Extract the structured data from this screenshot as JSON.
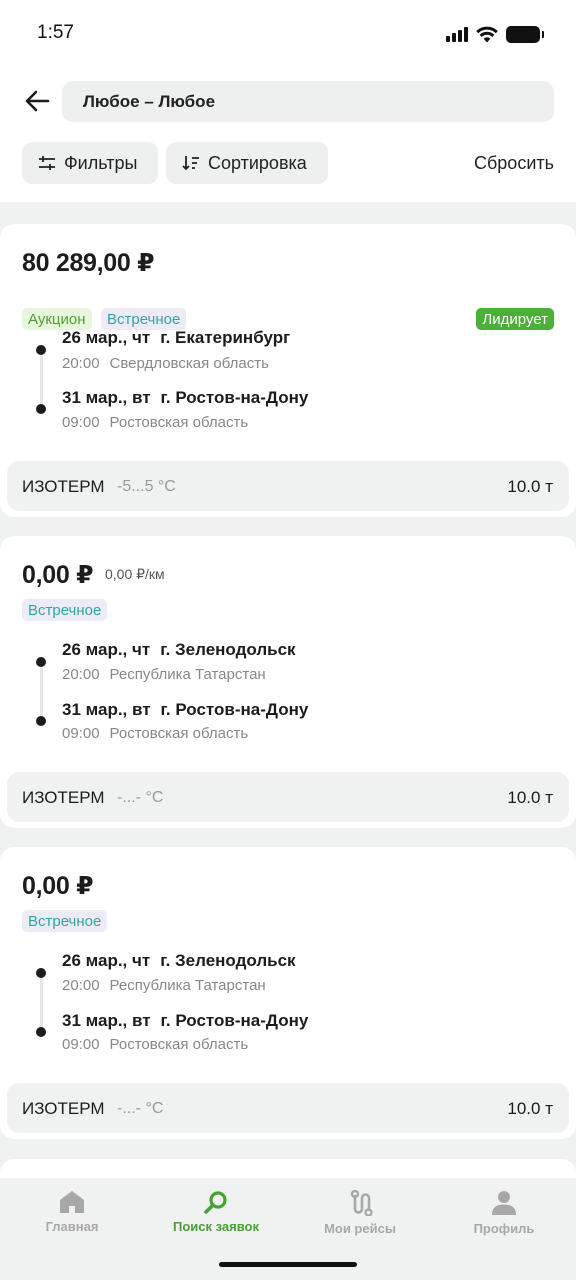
{
  "status_bar": {
    "time": "1:57"
  },
  "header": {
    "route": "Любое – Любое",
    "filters_label": "Фильтры",
    "sort_label": "Сортировка",
    "reset_label": "Сбросить"
  },
  "cards": [
    {
      "price": "80 289,00 ₽",
      "per_km": "",
      "badges": [
        "Аукцион",
        "Встречное"
      ],
      "status": "Лидирует",
      "from": {
        "date": "26 мар., чт",
        "city": "г. Екатеринбург",
        "time": "20:00",
        "region": "Свердловская область"
      },
      "to": {
        "date": "31 мар., вт",
        "city": "г. Ростов-на-Дону",
        "time": "09:00",
        "region": "Ростовская область"
      },
      "cargo": {
        "type": "ИЗОТЕРМ",
        "temp": "-5...5 °C",
        "weight": "10.0 т"
      }
    },
    {
      "price": "0,00 ₽",
      "per_km": "0,00 ₽/км",
      "badges": [
        "Встречное"
      ],
      "from": {
        "date": "26 мар., чт",
        "city": "г. Зеленодольск",
        "time": "20:00",
        "region": "Республика Татарстан"
      },
      "to": {
        "date": "31 мар., вт",
        "city": "г. Ростов-на-Дону",
        "time": "09:00",
        "region": "Ростовская область"
      },
      "cargo": {
        "type": "ИЗОТЕРМ",
        "temp": "-...- °C",
        "weight": "10.0 т"
      }
    },
    {
      "price": "0,00 ₽",
      "per_km": "",
      "badges": [
        "Встречное"
      ],
      "from": {
        "date": "26 мар., чт",
        "city": "г. Зеленодольск",
        "time": "20:00",
        "region": "Республика Татарстан"
      },
      "to": {
        "date": "31 мар., вт",
        "city": "г. Ростов-на-Дону",
        "time": "09:00",
        "region": "Ростовская область"
      },
      "cargo": {
        "type": "ИЗОТЕРМ",
        "temp": "-...- °C",
        "weight": "10.0 т"
      }
    }
  ],
  "nav": [
    {
      "label": "Главная",
      "icon": "home-icon",
      "active": false
    },
    {
      "label": "Поиск заявок",
      "icon": "search-icon",
      "active": true
    },
    {
      "label": "Мои рейсы",
      "icon": "route-icon",
      "active": false
    },
    {
      "label": "Профиль",
      "icon": "profile-icon",
      "active": false
    }
  ],
  "colors": {
    "accent": "#49a033",
    "leading_badge": "#4caf38",
    "counter_badge_text": "#36a3a3",
    "auction_badge_text": "#4da234"
  }
}
